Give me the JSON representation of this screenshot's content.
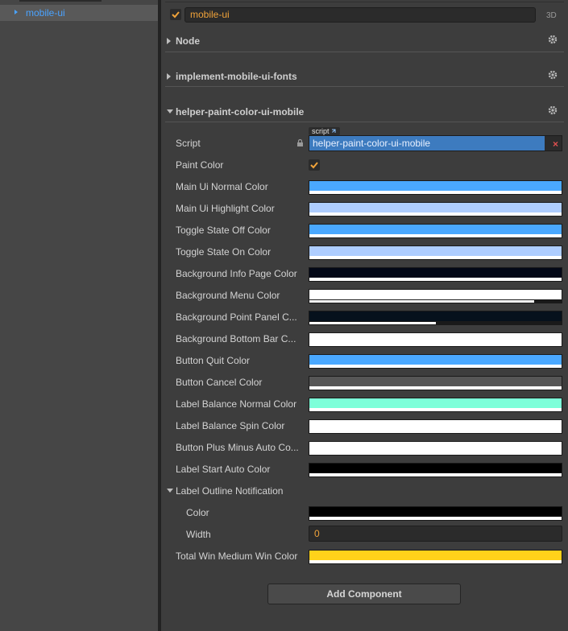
{
  "hierarchy": {
    "selected_node": "mobile-ui"
  },
  "node": {
    "enabled": true,
    "name": "mobile-ui",
    "mode_tag": "3D"
  },
  "sections": [
    {
      "title": "Node",
      "expanded": false
    },
    {
      "title": "implement-mobile-ui-fonts",
      "expanded": false
    },
    {
      "title": "helper-paint-color-ui-mobile",
      "expanded": true
    }
  ],
  "component": {
    "script_tag": "script",
    "script_label": "Script",
    "script_value": "helper-paint-color-ui-mobile",
    "script_clear": "×",
    "paint_color_label": "Paint Color",
    "paint_color_checked": true,
    "colors": [
      {
        "label": "Main Ui Normal Color",
        "color": "#4aa8ff",
        "alpha": 1.0
      },
      {
        "label": "Main Ui Highlight Color",
        "color": "#aecdff",
        "alpha": 1.0
      },
      {
        "label": "Toggle State Off Color",
        "color": "#4aa8ff",
        "alpha": 1.0
      },
      {
        "label": "Toggle State On Color",
        "color": "#aecdff",
        "alpha": 1.0
      },
      {
        "label": "Background Info Page Color",
        "color": "#030817",
        "alpha": 1.0
      },
      {
        "label": "Background Menu Color",
        "color": "#ffffff",
        "alpha": 0.89
      },
      {
        "label": "Background Point Panel C...",
        "color": "#06111c",
        "alpha": 0.5
      },
      {
        "label": "Background Bottom Bar C...",
        "color": "#ffffff",
        "alpha": 1.0
      },
      {
        "label": "Button Quit Color",
        "color": "#4aa8ff",
        "alpha": 1.0
      },
      {
        "label": "Button Cancel Color",
        "color": "#565656",
        "alpha": 1.0
      },
      {
        "label": "Label Balance Normal Color",
        "color": "#7dffd9",
        "alpha": 1.0
      },
      {
        "label": "Label Balance Spin Color",
        "color": "#ffffff",
        "alpha": 1.0
      },
      {
        "label": "Button Plus Minus Auto Co...",
        "color": "#ffffff",
        "alpha": 1.0
      },
      {
        "label": "Label Start Auto Color",
        "color": "#000000",
        "alpha": 1.0
      }
    ],
    "outline": {
      "title": "Label Outline Notification",
      "color_label": "Color",
      "color": "#000000",
      "width_label": "Width",
      "width_value": "0"
    },
    "total_win": {
      "label": "Total Win Medium Win Color",
      "color": "#ffd21a",
      "alpha": 1.0
    }
  },
  "add_component_label": "Add Component"
}
